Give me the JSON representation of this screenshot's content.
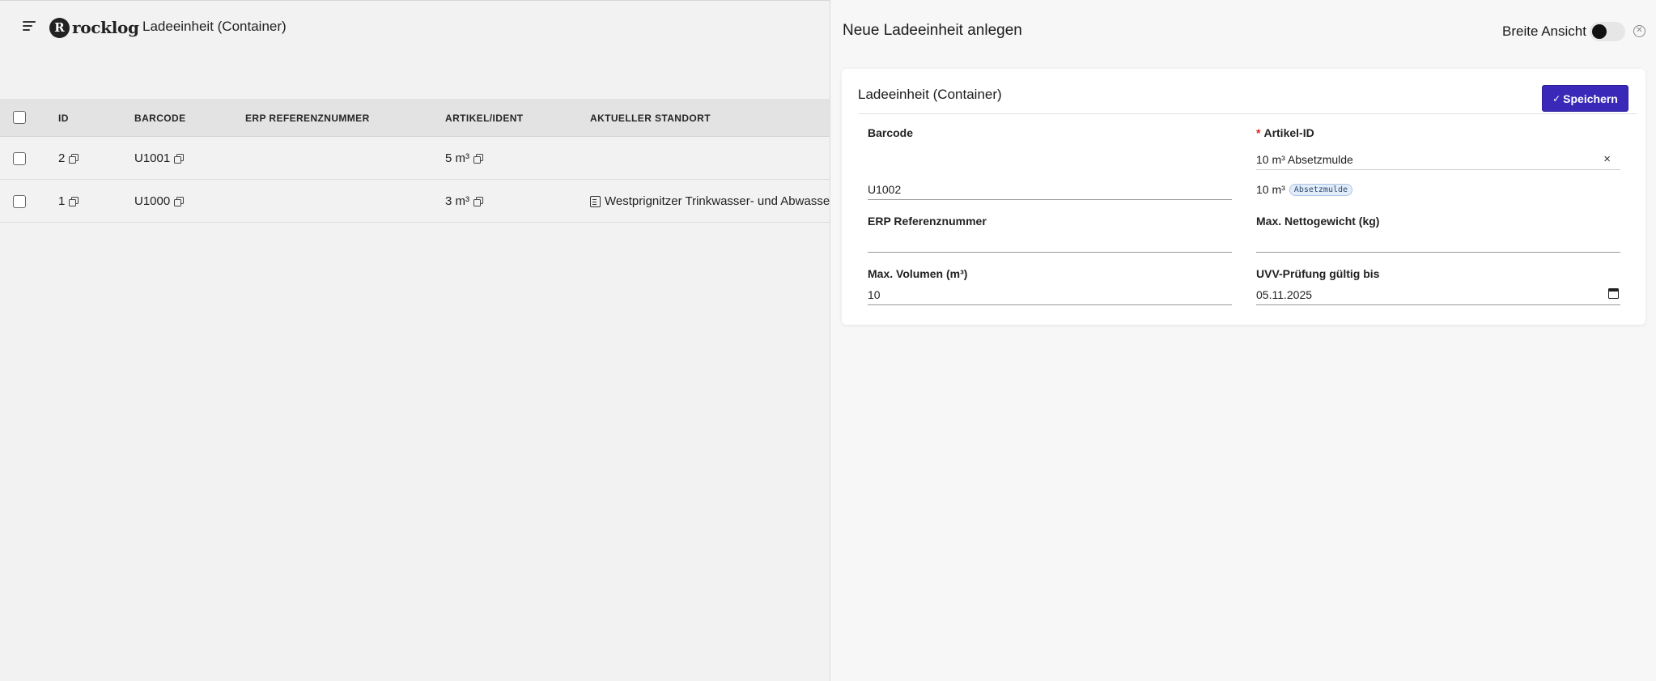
{
  "app": {
    "logo_mark": "R",
    "logo_text": "rocklog",
    "page_title": "Ladeeinheit (Container)"
  },
  "table": {
    "columns": [
      "ID",
      "BARCODE",
      "ERP REFERENZNUMMER",
      "ARTIKEL/IDENT",
      "AKTUELLER STANDORT"
    ],
    "rows": [
      {
        "id": "2",
        "barcode": "U1001",
        "erp": "",
        "artikel": "5 m³",
        "standort": ""
      },
      {
        "id": "1",
        "barcode": "U1000",
        "erp": "",
        "artikel": "3 m³",
        "standort": "Westprignitzer Trinkwasser- und Abwasser"
      }
    ]
  },
  "panel": {
    "title": "Neue Ladeeinheit anlegen",
    "wide_view_label": "Breite Ansicht",
    "wide_view_on": false,
    "close_icon": "circle-close-icon",
    "card_title": "Ladeeinheit (Container)",
    "save_label": "Speichern",
    "save_icon": "✓",
    "accent_color": "#3a29b8",
    "fields": {
      "barcode": {
        "label": "Barcode",
        "value": "U1002"
      },
      "artikel": {
        "label": "Artikel-ID",
        "required_mark": "*",
        "value": "10 m³ Absetzmulde",
        "selected_text": "10 m³",
        "selected_tag": "Absetzmulde",
        "clear": "×"
      },
      "erp": {
        "label": "ERP Referenznummer",
        "value": ""
      },
      "netto": {
        "label": "Max. Nettogewicht (kg)",
        "value": ""
      },
      "volumen": {
        "label": "Max. Volumen (m³)",
        "value": "10"
      },
      "uvv": {
        "label": "UVV-Prüfung gültig bis",
        "value": "05.11.2025"
      }
    }
  }
}
